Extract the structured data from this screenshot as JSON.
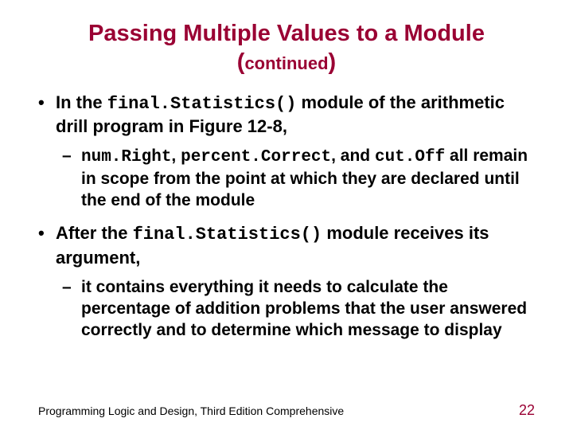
{
  "title": {
    "line1": "Passing Multiple Values to a Module",
    "paren_open": "(",
    "continued": "continued",
    "paren_close": ")"
  },
  "bullets": {
    "b1": {
      "pre": "In the ",
      "code": "final.Statistics()",
      "post": " module of the arithmetic drill program in Figure 12-8,",
      "sub": {
        "code1": "num.Right",
        "sep1": ", ",
        "code2": "percent.Correct",
        "sep2": ", and ",
        "code3": "cut.Off",
        "tail": " all remain in scope from the point at which they are declared until the end of the module"
      }
    },
    "b2": {
      "pre": "After the ",
      "code": "final.Statistics()",
      "post": " module receives its argument,",
      "sub": {
        "text": "it contains everything it needs to calculate the percentage of addition problems that the user answered correctly and to determine which message to display"
      }
    }
  },
  "footer": {
    "left": "Programming Logic and Design, Third Edition Comprehensive",
    "page": "22"
  }
}
